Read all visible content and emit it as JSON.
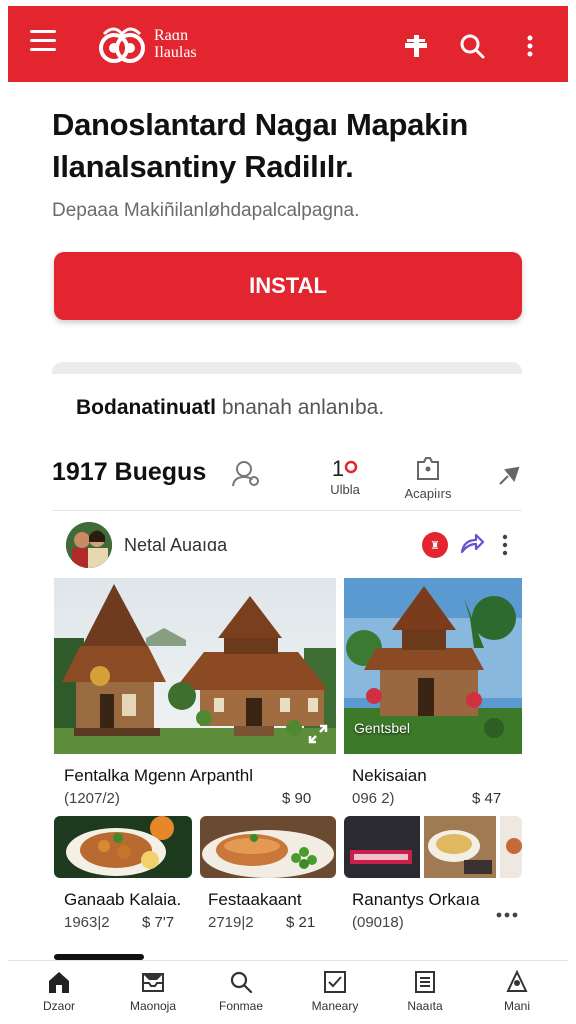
{
  "header": {
    "logo_text_line1": "Raɑn",
    "logo_text_line2": "Ilaulas",
    "brand_color": "#e3252f",
    "icons": [
      "menu-icon",
      "add-icon",
      "search-icon",
      "more-vertical-icon"
    ]
  },
  "hero": {
    "title": "Danoslantard Nagaı Mapakin Ilanalsantiny Radilılr.",
    "subtitle": "Depaaa Makiñilanløhdapalcalpagna.",
    "install_label": "INSTAL"
  },
  "tagline": {
    "strong": "Bodanatinuatl",
    "muted": " bnanah anlanıba."
  },
  "stats": {
    "title": "1917 Buegus",
    "items": [
      {
        "icon": "user-search-icon",
        "value": "",
        "label": ""
      },
      {
        "icon": "location-pin-icon",
        "value": "1",
        "label": "Ulbla"
      },
      {
        "icon": "camera-frame-icon",
        "value": "",
        "label": "Acapiırs"
      },
      {
        "icon": "pin-arrow-icon",
        "value": "",
        "label": ""
      }
    ]
  },
  "post": {
    "author": "Netal Auaıɑa",
    "badge": "♜"
  },
  "listings": [
    {
      "title": "Fentalka Mgenn Arpanthl",
      "meta": "(1207/2)",
      "price": "$ 90"
    },
    {
      "title": "Nekisaian",
      "meta": "096 2)",
      "price": "$ 47",
      "overlay": "Gentsbel"
    },
    {
      "title": "Ganaab Kalaia.",
      "meta": "1963|2",
      "price": "$ 7'7"
    },
    {
      "title": "Festaakaant",
      "meta": "2719|2",
      "price": "$ 21"
    },
    {
      "title": "Ranantys Orkaıa",
      "meta": "(09018)",
      "price": ""
    }
  ],
  "bottom_nav": [
    {
      "label": "Dzaor",
      "icon": "home-icon"
    },
    {
      "label": "Maonoja",
      "icon": "inbox-icon"
    },
    {
      "label": "Fonmae",
      "icon": "search-icon"
    },
    {
      "label": "Maneary",
      "icon": "checkbox-icon"
    },
    {
      "label": "Naaıta",
      "icon": "list-icon"
    },
    {
      "label": "Mani",
      "icon": "profile-icon"
    }
  ]
}
